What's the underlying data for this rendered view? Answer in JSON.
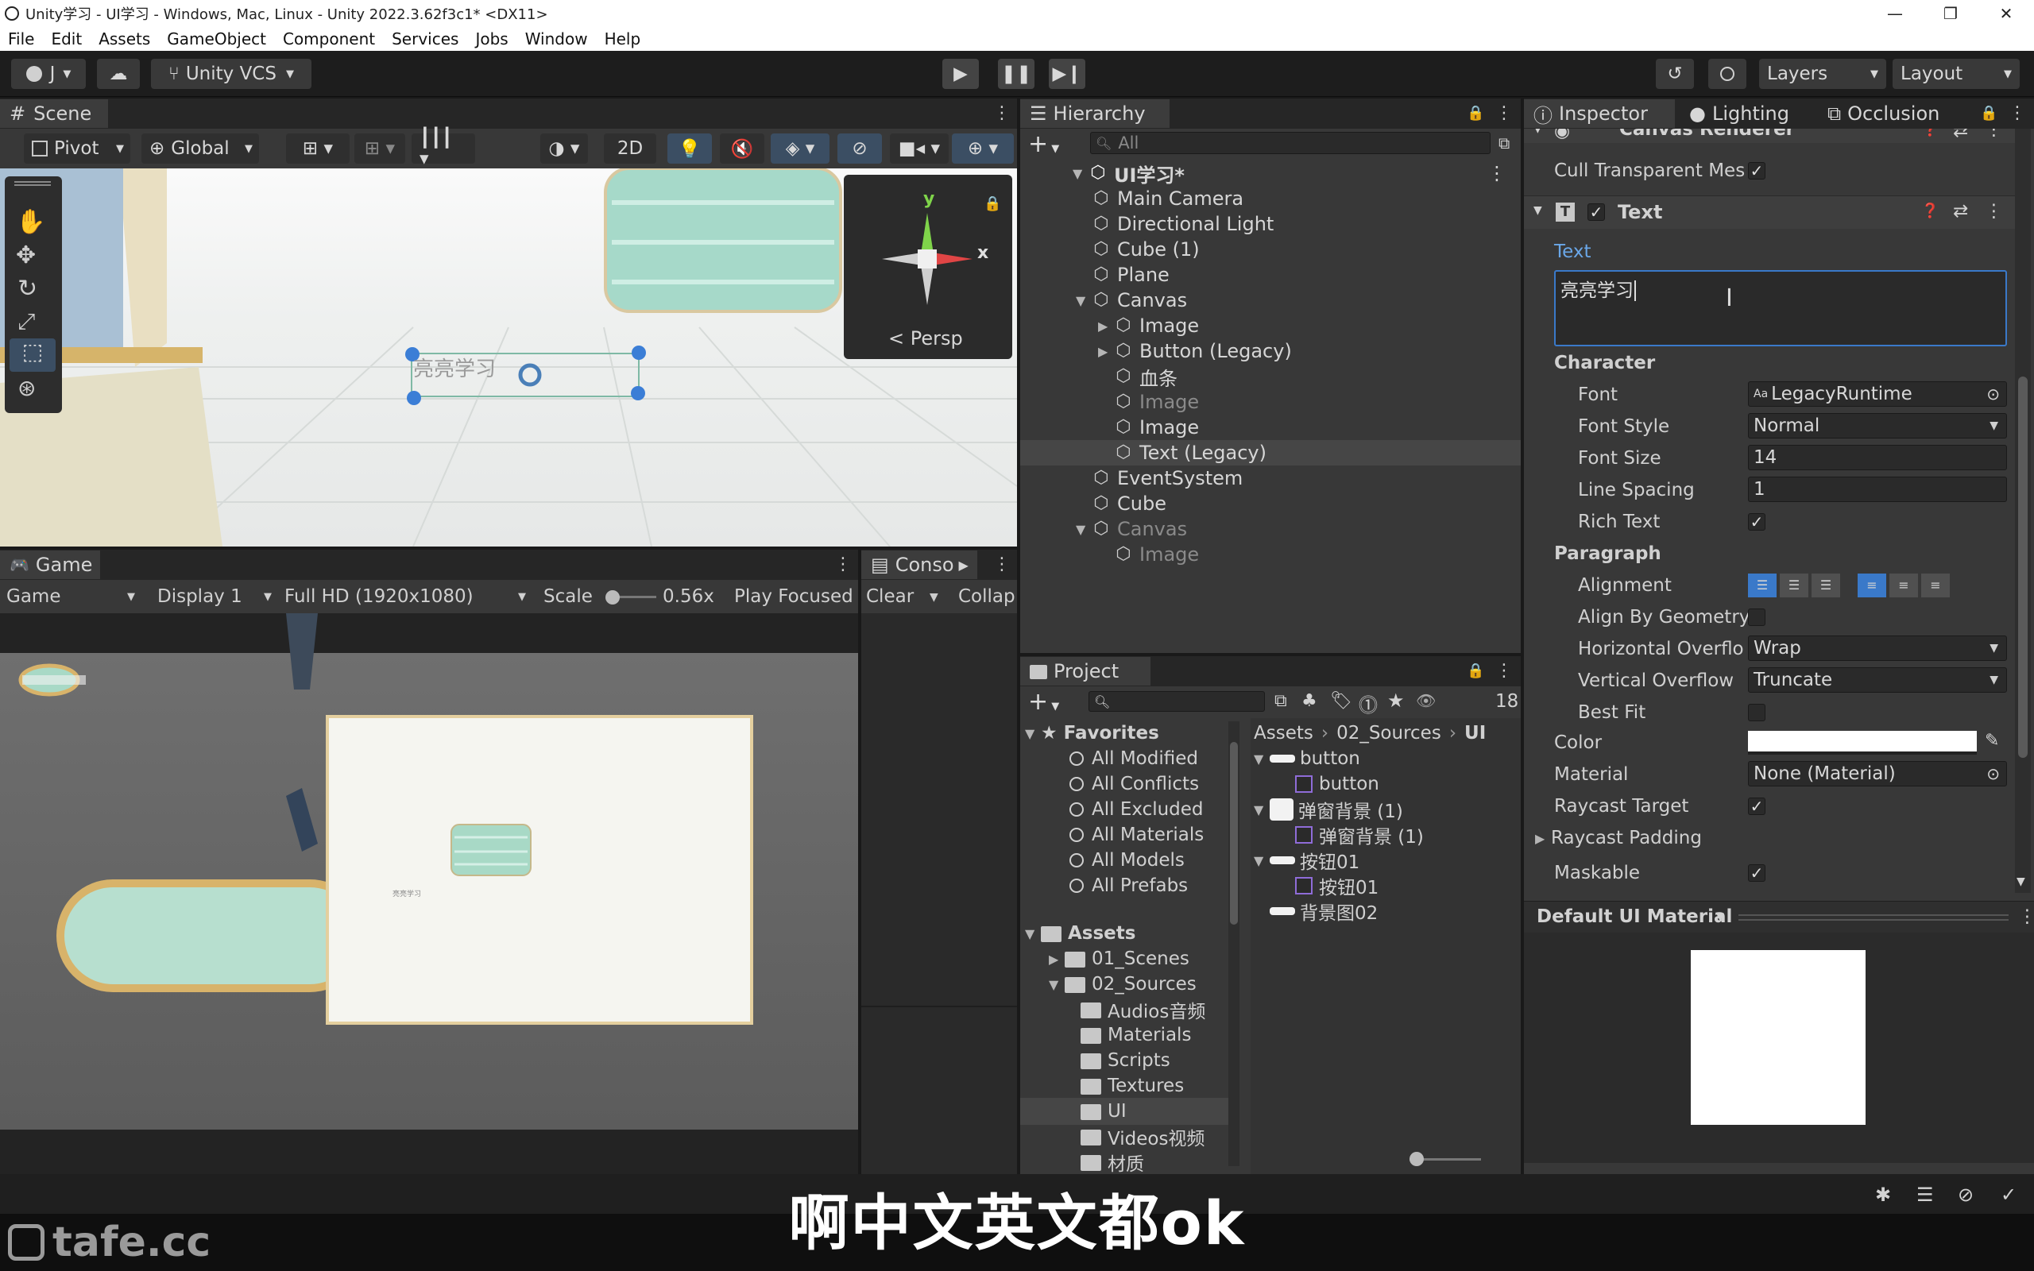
{
  "window": {
    "title": "Unity学习 - UI学习 - Windows, Mac, Linux - Unity 2022.3.62f3c1* <DX11>",
    "controls": [
      "—",
      "❐",
      "✕"
    ]
  },
  "menu": [
    "File",
    "Edit",
    "Assets",
    "GameObject",
    "Component",
    "Services",
    "Jobs",
    "Window",
    "Help"
  ],
  "toolbar": {
    "account": "J",
    "vcs": "Unity VCS",
    "layers": "Layers",
    "layout": "Layout"
  },
  "scene": {
    "tab": "Scene",
    "pivot": "Pivot",
    "global": "Global",
    "mode2d": "2D",
    "gizmo_y": "y",
    "gizmo_x": "x",
    "persp": "< Persp",
    "ui_text": "亮亮学习"
  },
  "game": {
    "tab": "Game",
    "mode": "Game",
    "display": "Display 1",
    "resolution": "Full HD (1920x1080)",
    "scale_label": "Scale",
    "scale_value": "0.56x",
    "play_focused": "Play Focused",
    "small_text": "亮亮学习"
  },
  "console": {
    "tab": "Conso",
    "clear": "Clear",
    "collapse": "Collap"
  },
  "hierarchy": {
    "tab": "Hierarchy",
    "search_placeholder": "All",
    "scene_root": "UI学习*",
    "items": [
      {
        "label": "Main Camera",
        "indent": 0,
        "dim": false
      },
      {
        "label": "Directional Light",
        "indent": 0,
        "dim": false
      },
      {
        "label": "Cube (1)",
        "indent": 0,
        "dim": false
      },
      {
        "label": "Plane",
        "indent": 0,
        "dim": false
      },
      {
        "label": "Canvas",
        "indent": 0,
        "dim": false
      },
      {
        "label": "Image",
        "indent": 1,
        "dim": false
      },
      {
        "label": "Button (Legacy)",
        "indent": 1,
        "dim": false
      },
      {
        "label": "血条",
        "indent": 1,
        "dim": false
      },
      {
        "label": "Image",
        "indent": 1,
        "dim": true
      },
      {
        "label": "Image",
        "indent": 1,
        "dim": false
      },
      {
        "label": "Text (Legacy)",
        "indent": 1,
        "dim": false
      },
      {
        "label": "EventSystem",
        "indent": 0,
        "dim": false
      },
      {
        "label": "Cube",
        "indent": 0,
        "dim": false
      },
      {
        "label": "Canvas",
        "indent": 0,
        "dim": true
      },
      {
        "label": "Image",
        "indent": 1,
        "dim": true
      }
    ]
  },
  "project": {
    "tab": "Project",
    "count": "18",
    "favorites_label": "Favorites",
    "favorites": [
      "All Modified",
      "All Conflicts",
      "All Excluded",
      "All Materials",
      "All Models",
      "All Prefabs"
    ],
    "assets_label": "Assets",
    "folders": [
      {
        "label": "01_Scenes",
        "indent": 1
      },
      {
        "label": "02_Sources",
        "indent": 1
      },
      {
        "label": "Audios音频",
        "indent": 2
      },
      {
        "label": "Materials",
        "indent": 2
      },
      {
        "label": "Scripts",
        "indent": 2
      },
      {
        "label": "Textures",
        "indent": 2
      },
      {
        "label": "UI",
        "indent": 2
      },
      {
        "label": "Videos视频",
        "indent": 2
      },
      {
        "label": "材质",
        "indent": 2
      }
    ],
    "breadcrumb": [
      "Assets",
      "02_Sources",
      "UI"
    ],
    "files": [
      {
        "label": "button",
        "indent": 0
      },
      {
        "label": "button",
        "indent": 1
      },
      {
        "label": "弹窗背景 (1)",
        "indent": 0
      },
      {
        "label": "弹窗背景 (1)",
        "indent": 1
      },
      {
        "label": "按钮01",
        "indent": 0
      },
      {
        "label": "按钮01",
        "indent": 1
      },
      {
        "label": "背景图02",
        "indent": 0
      }
    ]
  },
  "inspector": {
    "tabs": [
      "Inspector",
      "Lighting",
      "Occlusion"
    ],
    "canvas_renderer": "Canvas Renderer",
    "cull_label": "Cull Transparent Mes",
    "component": "Text",
    "text_label": "Text",
    "text_value": "亮亮学习",
    "character_label": "Character",
    "font_label": "Font",
    "font_value": "LegacyRuntime",
    "font_style_label": "Font Style",
    "font_style_value": "Normal",
    "font_size_label": "Font Size",
    "font_size_value": "14",
    "line_spacing_label": "Line Spacing",
    "line_spacing_value": "1",
    "rich_text_label": "Rich Text",
    "paragraph_label": "Paragraph",
    "alignment_label": "Alignment",
    "align_geometry_label": "Align By Geometry",
    "hoverflow_label": "Horizontal Overflo",
    "hoverflow_value": "Wrap",
    "voverflow_label": "Vertical Overflow",
    "voverflow_value": "Truncate",
    "best_fit_label": "Best Fit",
    "color_label": "Color",
    "material_label": "Material",
    "material_value": "None (Material)",
    "raycast_target_label": "Raycast Target",
    "raycast_padding_label": "Raycast Padding",
    "maskable_label": "Maskable",
    "default_material": "Default UI Material"
  },
  "watermark": "tafe.cc",
  "subtitle": "啊中文英文都ok"
}
